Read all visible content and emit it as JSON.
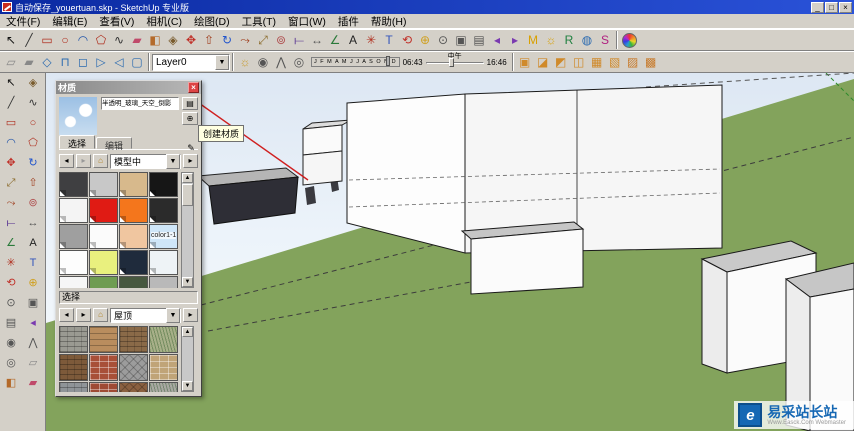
{
  "window": {
    "title": "自动保存_youertuan.skp - SketchUp 专业版",
    "buttons": [
      {
        "n": "minimize-button",
        "g": "_"
      },
      {
        "n": "maximize-button",
        "g": "□"
      },
      {
        "n": "close-button",
        "g": "×"
      }
    ]
  },
  "menu": {
    "items": [
      {
        "n": "menu-file",
        "label": "文件(F)"
      },
      {
        "n": "menu-edit",
        "label": "编辑(E)"
      },
      {
        "n": "menu-view",
        "label": "查看(V)"
      },
      {
        "n": "menu-camera",
        "label": "相机(C)"
      },
      {
        "n": "menu-draw",
        "label": "绘图(D)"
      },
      {
        "n": "menu-tools",
        "label": "工具(T)"
      },
      {
        "n": "menu-window",
        "label": "窗口(W)"
      },
      {
        "n": "menu-plugins",
        "label": "插件"
      },
      {
        "n": "menu-help",
        "label": "帮助(H)"
      }
    ]
  },
  "toolbar1": {
    "icons": [
      {
        "n": "select-tool-icon",
        "g": "↖",
        "c": "#111111"
      },
      {
        "n": "line-tool-icon",
        "g": "╱",
        "c": "#333333"
      },
      {
        "n": "rectangle-tool-icon",
        "g": "▭",
        "c": "#b03020"
      },
      {
        "n": "circle-tool-icon",
        "g": "○",
        "c": "#b03020"
      },
      {
        "n": "arc-tool-icon",
        "g": "◠",
        "c": "#2255aa"
      },
      {
        "n": "polygon-tool-icon",
        "g": "⬠",
        "c": "#b03020"
      },
      {
        "n": "freehand-tool-icon",
        "g": "∿",
        "c": "#333333"
      },
      {
        "n": "eraser-tool-icon",
        "g": "▰",
        "c": "#c04a6a"
      },
      {
        "n": "paint-bucket-icon",
        "g": "◧",
        "c": "#b46a2a"
      },
      {
        "n": "make-component-icon",
        "g": "◈",
        "c": "#7a5c2e"
      },
      {
        "n": "move-tool-icon",
        "g": "✥",
        "c": "#c03028"
      },
      {
        "n": "push-pull-icon",
        "g": "⇧",
        "c": "#a04020"
      },
      {
        "n": "rotate-tool-icon",
        "g": "↻",
        "c": "#2255cc"
      },
      {
        "n": "follow-me-icon",
        "g": "⤳",
        "c": "#a04020"
      },
      {
        "n": "scale-tool-icon",
        "g": "⤢",
        "c": "#8a6a2a"
      },
      {
        "n": "offset-tool-icon",
        "g": "⊚",
        "c": "#b05050"
      },
      {
        "n": "tape-measure-icon",
        "g": "⟝",
        "c": "#6a4a9a"
      },
      {
        "n": "dimension-tool-icon",
        "g": "↔",
        "c": "#555555"
      },
      {
        "n": "protractor-icon",
        "g": "∠",
        "c": "#2a7a3a"
      },
      {
        "n": "text-tool-icon",
        "g": "A",
        "c": "#222222"
      },
      {
        "n": "axes-tool-icon",
        "g": "✳",
        "c": "#b03020"
      },
      {
        "n": "3d-text-icon",
        "g": "T",
        "c": "#3355bb"
      },
      {
        "n": "orbit-tool-icon",
        "g": "⟲",
        "c": "#c03028"
      },
      {
        "n": "pan-tool-icon",
        "g": "⊕",
        "c": "#d0a020"
      },
      {
        "n": "zoom-tool-icon",
        "g": "⊙",
        "c": "#555555"
      },
      {
        "n": "zoom-window-icon",
        "g": "▣",
        "c": "#555555"
      },
      {
        "n": "zoom-extents-icon",
        "g": "▤",
        "c": "#555555"
      },
      {
        "n": "previous-view-icon",
        "g": "◂",
        "c": "#7a3ab0"
      },
      {
        "n": "next-view-icon",
        "g": "▸",
        "c": "#7a3ab0"
      },
      {
        "n": "model-info-badge-icon",
        "g": "M",
        "c": "#d8a000"
      },
      {
        "n": "instructor-bulb-icon",
        "g": "☼",
        "c": "#d8a000"
      },
      {
        "n": "ruby-badge-icon",
        "g": "R",
        "c": "#208040"
      },
      {
        "n": "globe-icon",
        "g": "◍",
        "c": "#2a6ab0"
      },
      {
        "n": "style-badge-icon",
        "g": "S",
        "c": "#b02080"
      }
    ]
  },
  "toolbar2": {
    "left_icons": [
      {
        "n": "section-plane-icon",
        "g": "▱",
        "c": "#888888"
      },
      {
        "n": "section-fill-icon",
        "g": "▰",
        "c": "#888888"
      },
      {
        "n": "iso-view-icon",
        "g": "◇",
        "c": "#2a6ab0"
      },
      {
        "n": "top-view-icon",
        "g": "⊓",
        "c": "#2a6ab0"
      },
      {
        "n": "front-view-icon",
        "g": "◻",
        "c": "#2a6ab0"
      },
      {
        "n": "right-view-icon",
        "g": "▷",
        "c": "#2a6ab0"
      },
      {
        "n": "left-view-icon",
        "g": "◁",
        "c": "#2a6ab0"
      },
      {
        "n": "back-view-icon",
        "g": "▢",
        "c": "#2a6ab0"
      }
    ],
    "layer_value": "Layer0",
    "shadow": {
      "months": "J F M A M J J A S O N D",
      "time_start": "06:43",
      "noon": "中午",
      "time_end": "16:46"
    },
    "mid_icons": [
      {
        "n": "shadow-toggle-icon",
        "g": "☼",
        "c": "#c89a2a"
      },
      {
        "n": "position-camera-icon",
        "g": "◉",
        "c": "#555555"
      },
      {
        "n": "walk-tool-icon",
        "g": "⋀",
        "c": "#555555"
      },
      {
        "n": "look-around-icon",
        "g": "◎",
        "c": "#555555"
      }
    ],
    "right_icons": [
      {
        "n": "solid-union-icon",
        "g": "▣",
        "c": "#d08a2a"
      },
      {
        "n": "solid-subtract-icon",
        "g": "◪",
        "c": "#d08a2a"
      },
      {
        "n": "solid-intersect-icon",
        "g": "◩",
        "c": "#d08a2a"
      },
      {
        "n": "solid-trim-icon",
        "g": "◫",
        "c": "#d08a2a"
      },
      {
        "n": "solid-split-icon",
        "g": "▦",
        "c": "#d08a2a"
      },
      {
        "n": "solid-shell-icon",
        "g": "▧",
        "c": "#d08a2a"
      },
      {
        "n": "warehouse-box-icon",
        "g": "▨",
        "c": "#c87a2a"
      },
      {
        "n": "component-box-icon",
        "g": "▩",
        "c": "#c87a2a"
      }
    ]
  },
  "left_toolbar": {
    "icons": [
      {
        "n": "select-tool-icon",
        "g": "↖",
        "c": "#111111"
      },
      {
        "n": "make-component-icon",
        "g": "◈",
        "c": "#7a5c2e"
      },
      {
        "n": "line-tool-icon",
        "g": "╱",
        "c": "#333333"
      },
      {
        "n": "freehand-tool-icon",
        "g": "∿",
        "c": "#333333"
      },
      {
        "n": "rectangle-tool-icon",
        "g": "▭",
        "c": "#b03020"
      },
      {
        "n": "circle-tool-icon",
        "g": "○",
        "c": "#b03020"
      },
      {
        "n": "arc-tool-icon",
        "g": "◠",
        "c": "#2255aa"
      },
      {
        "n": "polygon-tool-icon",
        "g": "⬠",
        "c": "#b03020"
      },
      {
        "n": "move-tool-icon",
        "g": "✥",
        "c": "#c03028"
      },
      {
        "n": "rotate-tool-icon",
        "g": "↻",
        "c": "#2255cc"
      },
      {
        "n": "scale-tool-icon",
        "g": "⤢",
        "c": "#8a6a2a"
      },
      {
        "n": "push-pull-icon",
        "g": "⇧",
        "c": "#a04020"
      },
      {
        "n": "follow-me-icon",
        "g": "⤳",
        "c": "#a04020"
      },
      {
        "n": "offset-tool-icon",
        "g": "⊚",
        "c": "#b05050"
      },
      {
        "n": "tape-measure-icon",
        "g": "⟝",
        "c": "#6a4a9a"
      },
      {
        "n": "dimension-tool-icon",
        "g": "↔",
        "c": "#555555"
      },
      {
        "n": "protractor-icon",
        "g": "∠",
        "c": "#2a7a3a"
      },
      {
        "n": "text-tool-icon",
        "g": "A",
        "c": "#222222"
      },
      {
        "n": "axes-tool-icon",
        "g": "✳",
        "c": "#b03020"
      },
      {
        "n": "3d-text-icon",
        "g": "T",
        "c": "#3355bb"
      },
      {
        "n": "orbit-tool-icon",
        "g": "⟲",
        "c": "#c03028"
      },
      {
        "n": "pan-tool-icon",
        "g": "⊕",
        "c": "#d0a020"
      },
      {
        "n": "zoom-tool-icon",
        "g": "⊙",
        "c": "#555555"
      },
      {
        "n": "zoom-window-icon",
        "g": "▣",
        "c": "#555555"
      },
      {
        "n": "zoom-extents-icon",
        "g": "▤",
        "c": "#555555"
      },
      {
        "n": "previous-view-icon",
        "g": "◂",
        "c": "#7a3ab0"
      },
      {
        "n": "position-camera-icon",
        "g": "◉",
        "c": "#555555"
      },
      {
        "n": "walk-tool-icon",
        "g": "⋀",
        "c": "#555555"
      },
      {
        "n": "look-around-icon",
        "g": "◎",
        "c": "#555555"
      },
      {
        "n": "section-plane-icon",
        "g": "▱",
        "c": "#888888"
      },
      {
        "n": "paint-bucket-icon",
        "g": "◧",
        "c": "#b46a2a"
      },
      {
        "n": "eraser-tool-icon",
        "g": "▰",
        "c": "#c04a6a"
      }
    ]
  },
  "materials_dialog": {
    "title": "材质",
    "close": "×",
    "name_value": "半透明_玻璃_天空_倒影",
    "display_btn": "▤",
    "create_btn": "⊕",
    "dropper": "✎",
    "tabs": [
      {
        "n": "tab-select",
        "label": "选择"
      },
      {
        "n": "tab-edit",
        "label": "编辑"
      }
    ],
    "nav": {
      "back": "◂",
      "fwd": "▸",
      "home": "⌂",
      "detail": "▸"
    },
    "model_combo": "模型中",
    "swatches": [
      {
        "n": "material-swatch",
        "c": "#3f3f41"
      },
      {
        "n": "material-swatch",
        "c": "#c8c8c8"
      },
      {
        "n": "material-swatch",
        "c": "#d7b98c"
      },
      {
        "n": "material-swatch",
        "c": "#161616"
      },
      {
        "n": "material-swatch",
        "c": "#f4f4f4"
      },
      {
        "n": "material-swatch",
        "c": "#e01b14"
      },
      {
        "n": "material-swatch",
        "c": "#f4761c"
      },
      {
        "n": "material-swatch",
        "c": "#2b2b2b"
      },
      {
        "n": "material-swatch",
        "c": "#9f9f9f"
      },
      {
        "n": "material-swatch",
        "c": "#fbfbfb"
      },
      {
        "n": "material-swatch",
        "c": "#f0c6a0"
      },
      {
        "n": "material-swatch",
        "c": "#cfe6f8",
        "label": "color1-1"
      },
      {
        "n": "material-swatch",
        "c": "#fdfdfd"
      },
      {
        "n": "material-swatch",
        "c": "#e9f07e"
      },
      {
        "n": "material-swatch",
        "c": "#1f2b3c"
      },
      {
        "n": "material-swatch",
        "c": "#eef3f6"
      },
      {
        "n": "material-swatch",
        "c": "#f6f6f6"
      },
      {
        "n": "material-swatch",
        "c": "#6f9c52"
      },
      {
        "n": "material-swatch",
        "c": "#47583f"
      },
      {
        "n": "material-swatch",
        "c": "#b9b9b9"
      }
    ],
    "select_header": "选择",
    "library_combo": "屋顶",
    "textures": [
      {
        "n": "texture-gray-shingles",
        "c": "#9a9a92",
        "p": "shingle"
      },
      {
        "n": "texture-clay-tiles",
        "c": "#b98d5e",
        "p": "tile"
      },
      {
        "n": "texture-brown-shingles",
        "c": "#8a6a48",
        "p": "shingle"
      },
      {
        "n": "texture-green-roof",
        "c": "#a8b089",
        "p": "grass"
      },
      {
        "n": "texture-wood-shakes",
        "c": "#7d5a3a",
        "p": "shingle"
      },
      {
        "n": "texture-red-brick",
        "c": "#a85038",
        "p": "brick"
      },
      {
        "n": "texture-gray-pavers",
        "c": "#9c9c9c",
        "p": "pavers"
      },
      {
        "n": "texture-tan-stone",
        "c": "#c0a478",
        "p": "brick"
      },
      {
        "n": "texture-slate",
        "c": "#8f9498",
        "p": "shingle"
      },
      {
        "n": "texture-brick-small",
        "c": "#9e4a34",
        "p": "brick"
      },
      {
        "n": "texture-herringbone",
        "c": "#8a6040",
        "p": "pavers"
      },
      {
        "n": "texture-gravel",
        "c": "#a9a9a2",
        "p": "grass"
      }
    ],
    "tooltip": "创建材质"
  },
  "viewport_colors": {
    "ground": "#83a35c",
    "sky_top": "#dde7f3",
    "inference_red": "#d02020",
    "axis_green": "#2a8a2a"
  },
  "watermark": {
    "logo": "e",
    "title": "易采站长站",
    "subtitle": "Www.Easck.Com Webmaster"
  }
}
